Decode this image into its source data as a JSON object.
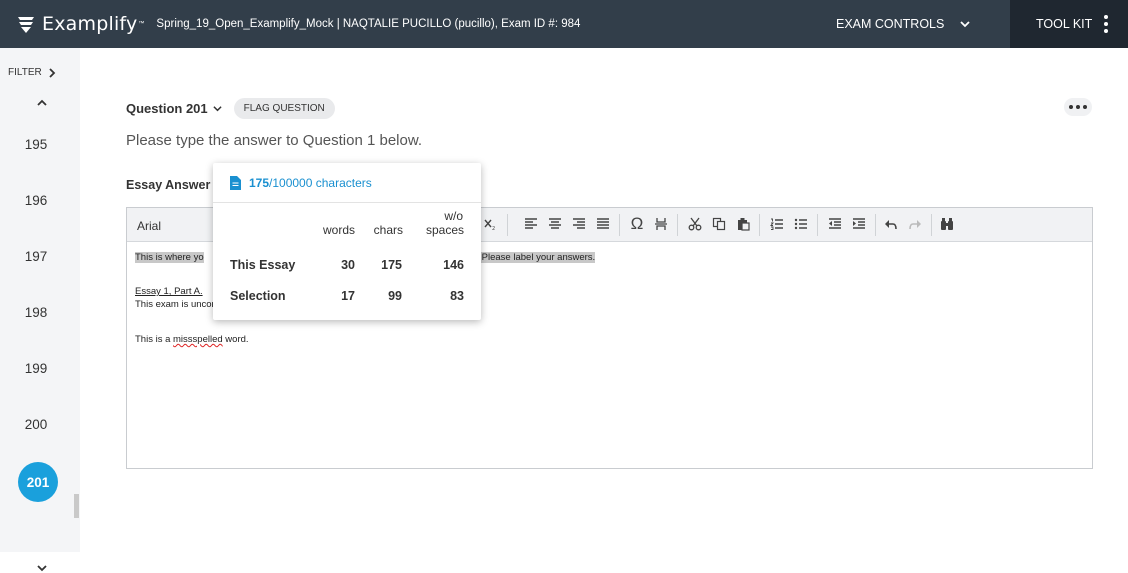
{
  "app": {
    "logo_text": "Examplify",
    "logo_tm": "™",
    "exam_title": "Spring_19_Open_Examplify_Mock | NAQTALIE PUCILLO (pucillo), Exam ID #: 984",
    "exam_controls_label": "EXAM CONTROLS",
    "toolkit_label": "TOOL KIT"
  },
  "sidebar": {
    "filter_label": "FILTER",
    "questions": [
      "195",
      "196",
      "197",
      "198",
      "199",
      "200",
      "201"
    ],
    "active_question": "201"
  },
  "question": {
    "label": "Question 201",
    "flag_label": "FLAG QUESTION",
    "prompt": "Please type the answer to Question 1 below.",
    "essay_label": "Essay Answer"
  },
  "editor": {
    "font": "Arial",
    "lines": {
      "line1_start": "This is where yo",
      "line1_end": "s. Please label your answers.",
      "line2": "Essay 1, Part A.",
      "line3": "This exam is unconstitutional.",
      "line4_a": "This is a ",
      "line4_b": "missspelled",
      "line4_c": " word."
    }
  },
  "word_count": {
    "count": "175",
    "limit_text": " /100000 characters",
    "col_words": "words",
    "col_chars": "chars",
    "col_wo": "w/o",
    "col_spaces": "spaces",
    "rows": [
      {
        "label": "This Essay",
        "words": "30",
        "chars": "175",
        "wo": "146"
      },
      {
        "label": "Selection",
        "words": "17",
        "chars": "99",
        "wo": "83"
      }
    ]
  },
  "colors": {
    "topbar": "#323e4a",
    "toolkit": "#1f2730",
    "accent": "#1aa0dc",
    "link": "#1a90d0"
  }
}
